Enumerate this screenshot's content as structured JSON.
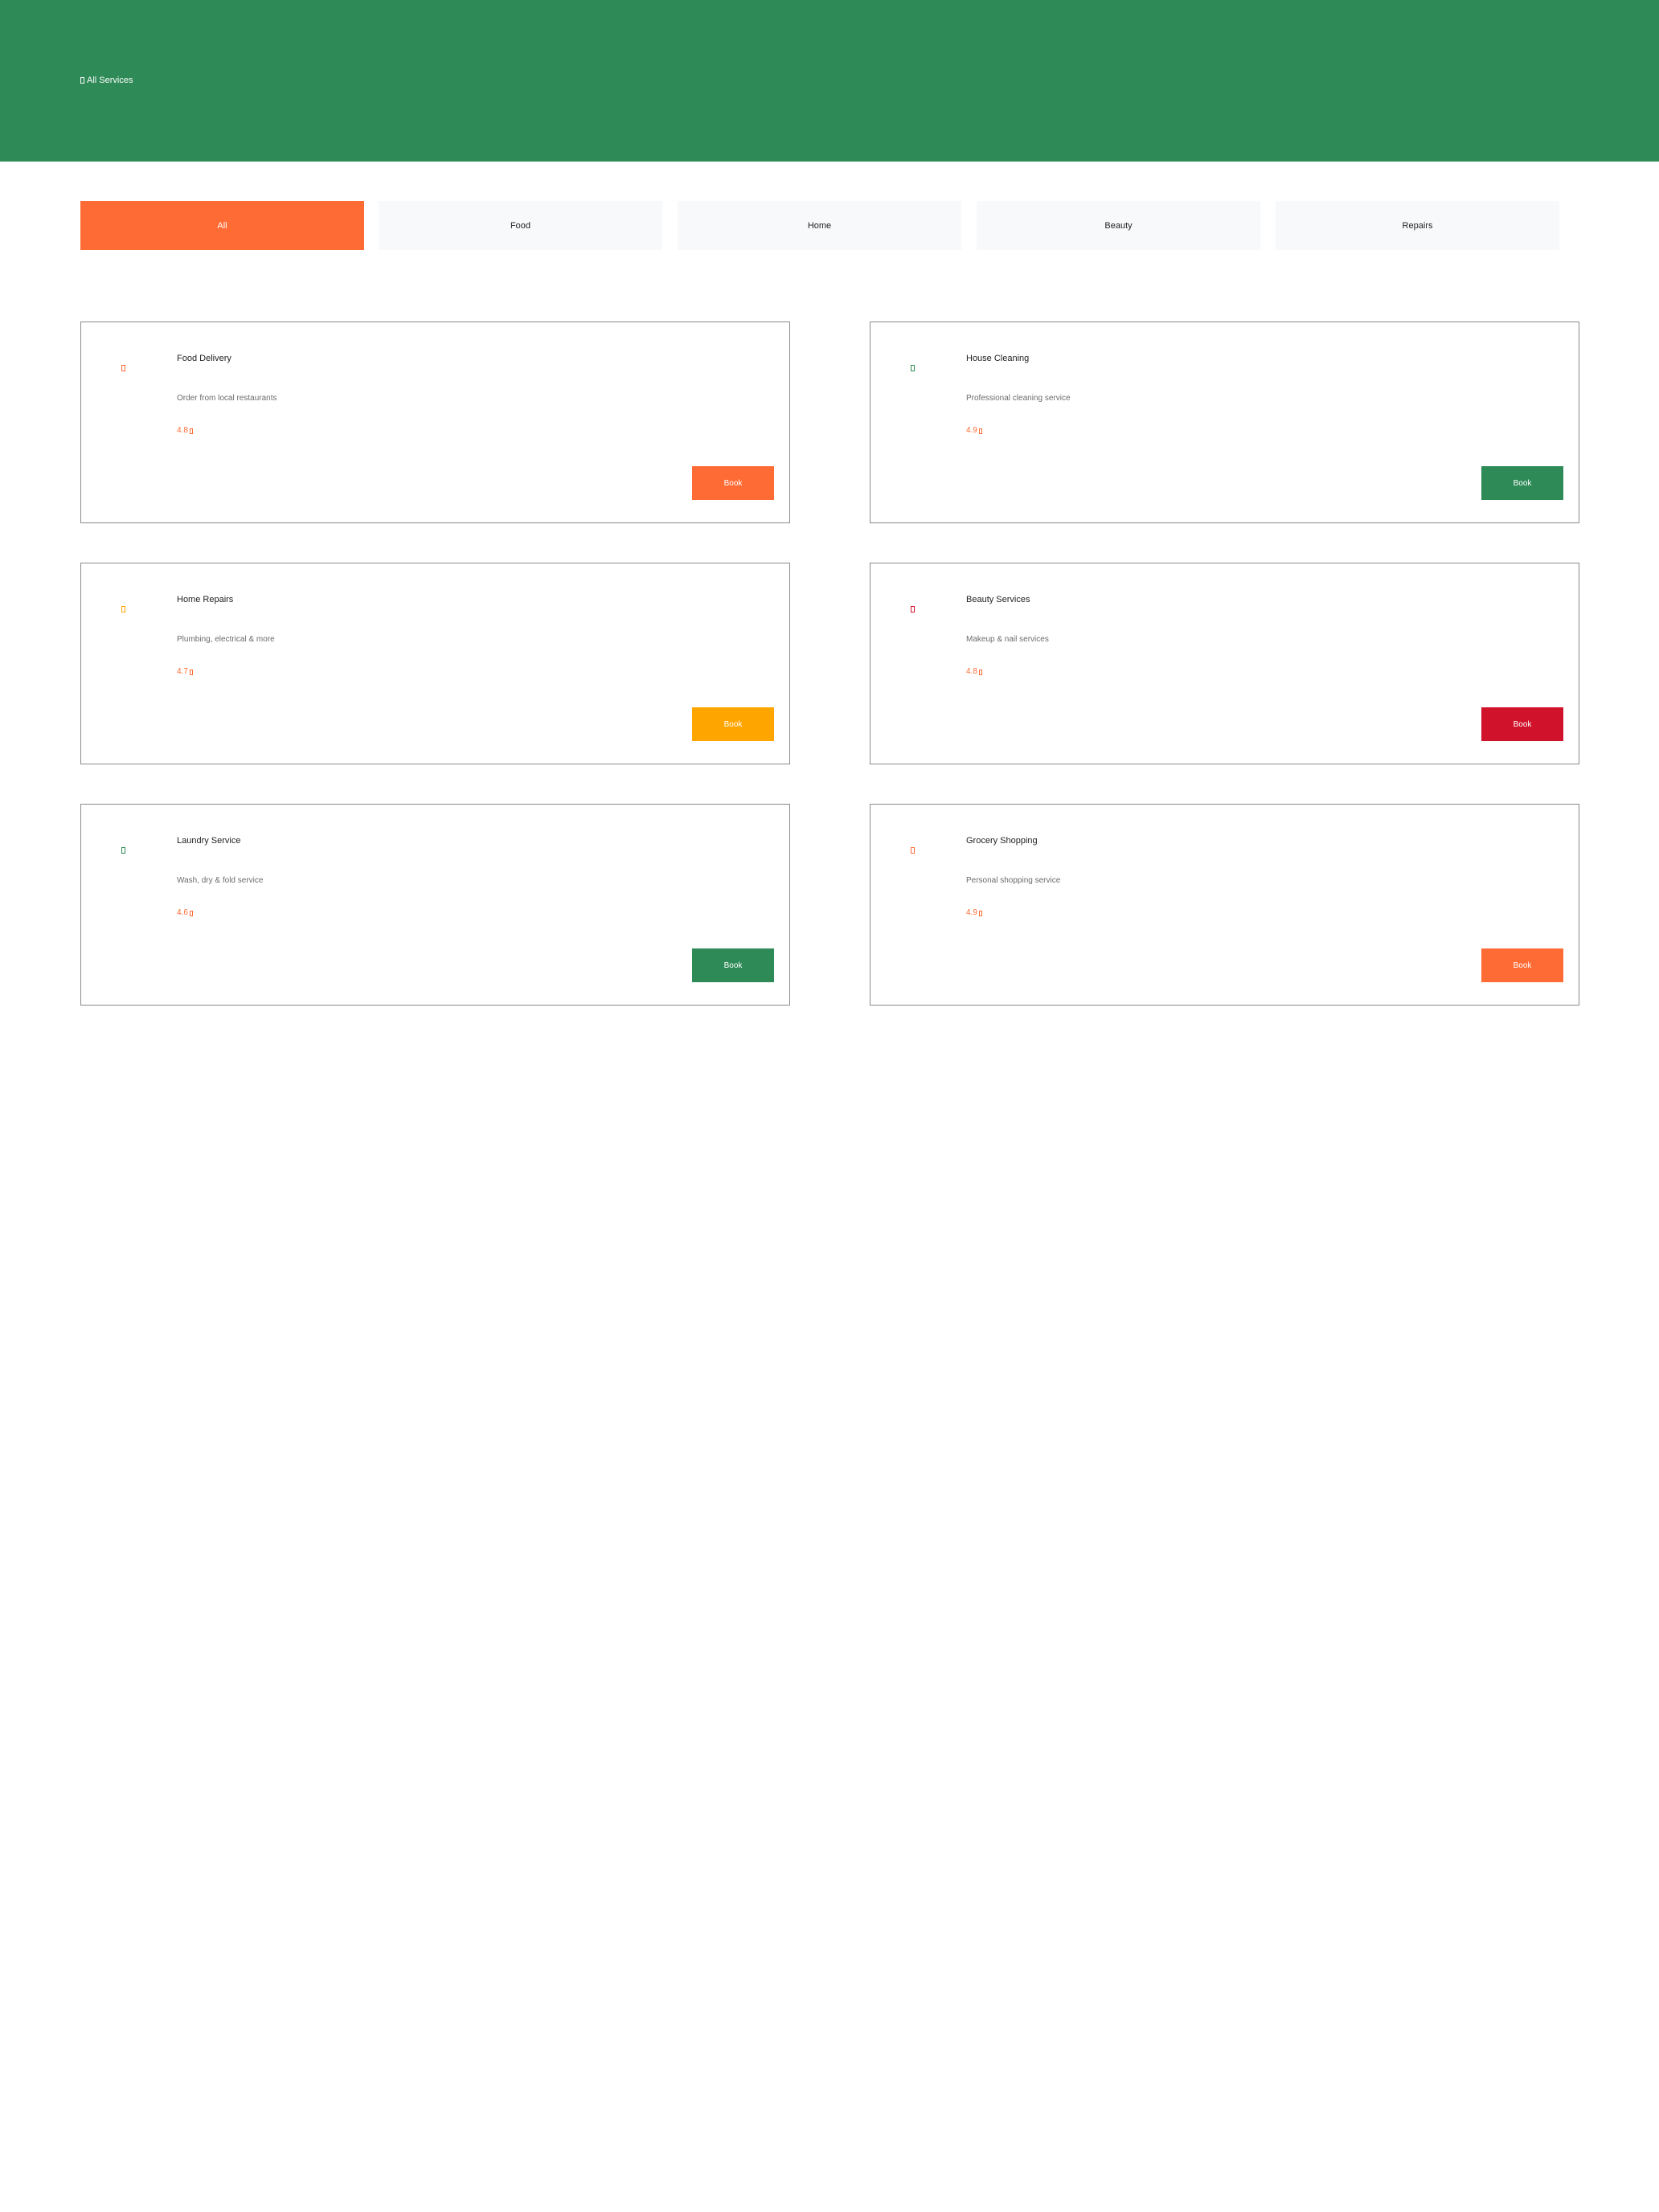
{
  "header": {
    "title": "All Services",
    "icon": "grid-icon",
    "background": "#2e8b57"
  },
  "tabs": [
    {
      "label": "All",
      "active": true
    },
    {
      "label": "Food",
      "active": false
    },
    {
      "label": "Home",
      "active": false
    },
    {
      "label": "Beauty",
      "active": false
    },
    {
      "label": "Repairs",
      "active": false
    }
  ],
  "colors": {
    "accent": "#ff6b35",
    "green": "#2e8b57",
    "amber": "#ffa500",
    "red": "#d0122b",
    "tab_inactive_bg": "#f8f9fa"
  },
  "services": [
    {
      "title": "Food Delivery",
      "description": "Order from local restaurants",
      "rating": "4.8",
      "button": "Book",
      "color": "#ff6b35",
      "icon": "food-icon"
    },
    {
      "title": "House Cleaning",
      "description": "Professional cleaning service",
      "rating": "4.9",
      "button": "Book",
      "color": "#2e8b57",
      "icon": "cleaning-icon"
    },
    {
      "title": "Home Repairs",
      "description": "Plumbing, electrical & more",
      "rating": "4.7",
      "button": "Book",
      "color": "#ffa500",
      "icon": "repair-icon"
    },
    {
      "title": "Beauty Services",
      "description": "Makeup & nail services",
      "rating": "4.8",
      "button": "Book",
      "color": "#d0122b",
      "icon": "beauty-icon"
    },
    {
      "title": "Laundry Service",
      "description": "Wash, dry & fold service",
      "rating": "4.6",
      "button": "Book",
      "color": "#2e8b57",
      "icon": "laundry-icon"
    },
    {
      "title": "Grocery Shopping",
      "description": "Personal shopping service",
      "rating": "4.9",
      "button": "Book",
      "color": "#ff6b35",
      "icon": "grocery-icon"
    }
  ]
}
